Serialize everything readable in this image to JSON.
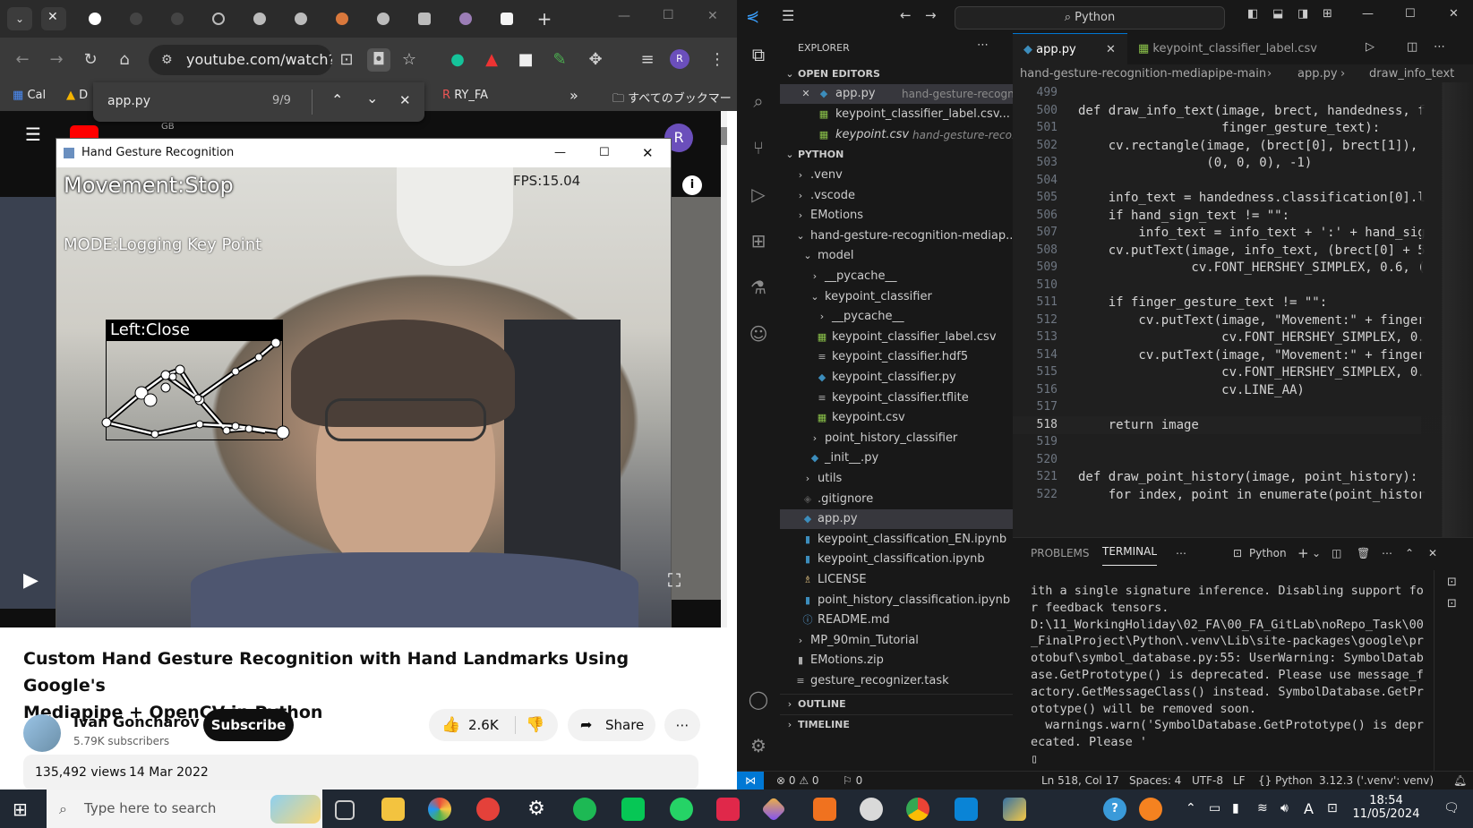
{
  "chrome": {
    "url": "youtube.com/watch?v...",
    "bookmarks": {
      "b1": "Cal",
      "b2": "D",
      "b3": "RY_FA",
      "all": "すべてのブックマーク",
      "more": "»"
    },
    "find": {
      "query": "app.py",
      "count": "9/9"
    },
    "window": {
      "minimize": "—",
      "maximize": "☐",
      "close": "✕"
    }
  },
  "cv_window": {
    "title": "Hand Gesture Recognition",
    "movement": "Movement:Stop",
    "fps": "FPS:15.04",
    "mode": "MODE:Logging Key Point",
    "hand_label": "Left:Close"
  },
  "youtube": {
    "video_title_line1": "Custom Hand Gesture Recognition with Hand Landmarks Using Google's",
    "video_title_line2": "Mediapipe + OpenCV in Python",
    "channel": "Ivan Goncharov",
    "subscribers": "5.79K subscribers",
    "subscribe": "Subscribe",
    "likes": "2.6K",
    "share": "Share",
    "views": "135,492 views",
    "date": "14 Mar 2022",
    "header_badge": "GB",
    "avatar_letter": "R"
  },
  "vscode": {
    "search": "Python",
    "explorer_title": "EXPLORER",
    "open_editors": "OPEN EDITORS",
    "open_files": [
      {
        "name": "app.py",
        "path": "hand-gesture-recogniti...",
        "icon": "python-icon",
        "close": true
      },
      {
        "name": "keypoint_classifier_label.csv...",
        "path": "",
        "icon": "csv-icon"
      },
      {
        "name": "keypoint.csv",
        "path": "hand-gesture-reco...",
        "icon": "csv-icon",
        "italic": true
      }
    ],
    "root": "PYTHON",
    "tree": [
      {
        "label": ".venv",
        "indent": 1,
        "kind": "folder",
        "open": false
      },
      {
        "label": ".vscode",
        "indent": 1,
        "kind": "folder",
        "open": false
      },
      {
        "label": "EMotions",
        "indent": 1,
        "kind": "folder",
        "open": false
      },
      {
        "label": "hand-gesture-recognition-mediap...",
        "indent": 1,
        "kind": "folder",
        "open": true
      },
      {
        "label": "model",
        "indent": 2,
        "kind": "folder",
        "open": true
      },
      {
        "label": "__pycache__",
        "indent": 3,
        "kind": "folder",
        "open": false
      },
      {
        "label": "keypoint_classifier",
        "indent": 3,
        "kind": "folder",
        "open": true
      },
      {
        "label": "__pycache__",
        "indent": 4,
        "kind": "folder",
        "open": false
      },
      {
        "label": "keypoint_classifier_label.csv",
        "indent": 4,
        "kind": "csv"
      },
      {
        "label": "keypoint_classifier.hdf5",
        "indent": 4,
        "kind": "txt"
      },
      {
        "label": "keypoint_classifier.py",
        "indent": 4,
        "kind": "py"
      },
      {
        "label": "keypoint_classifier.tflite",
        "indent": 4,
        "kind": "txt"
      },
      {
        "label": "keypoint.csv",
        "indent": 4,
        "kind": "csv"
      },
      {
        "label": "point_history_classifier",
        "indent": 3,
        "kind": "folder",
        "open": false
      },
      {
        "label": "_init__.py",
        "indent": 3,
        "kind": "py"
      },
      {
        "label": "utils",
        "indent": 2,
        "kind": "folder",
        "open": false
      },
      {
        "label": ".gitignore",
        "indent": 2,
        "kind": "git"
      },
      {
        "label": "app.py",
        "indent": 2,
        "kind": "py",
        "selected": true
      },
      {
        "label": "keypoint_classification_EN.ipynb",
        "indent": 2,
        "kind": "nb"
      },
      {
        "label": "keypoint_classification.ipynb",
        "indent": 2,
        "kind": "nb"
      },
      {
        "label": "LICENSE",
        "indent": 2,
        "kind": "lic"
      },
      {
        "label": "point_history_classification.ipynb",
        "indent": 2,
        "kind": "nb"
      },
      {
        "label": "README.md",
        "indent": 2,
        "kind": "md"
      },
      {
        "label": "MP_90min_Tutorial",
        "indent": 1,
        "kind": "folder",
        "open": false
      },
      {
        "label": "EMotions.zip",
        "indent": 1,
        "kind": "zip"
      },
      {
        "label": "gesture_recognizer.task",
        "indent": 1,
        "kind": "txt"
      }
    ],
    "outline": "OUTLINE",
    "timeline": "TIMELINE",
    "tabs": [
      {
        "label": "app.py",
        "active": true
      },
      {
        "label": "keypoint_classifier_label.csv",
        "active": false
      }
    ],
    "breadcrumb": [
      "hand-gesture-recognition-mediapipe-main",
      "app.py",
      "draw_info_text"
    ],
    "code": [
      {
        "n": "499",
        "t": ""
      },
      {
        "n": "500",
        "t": "def draw_info_text(image, brect, handedness, f"
      },
      {
        "n": "501",
        "t": "                   finger_gesture_text):"
      },
      {
        "n": "502",
        "t": "    cv.rectangle(image, (brect[0], brect[1]),"
      },
      {
        "n": "503",
        "t": "                 (0, 0, 0), -1)"
      },
      {
        "n": "504",
        "t": ""
      },
      {
        "n": "505",
        "t": "    info_text = handedness.classification[0].l"
      },
      {
        "n": "506",
        "t": "    if hand_sign_text != \"\":"
      },
      {
        "n": "507",
        "t": "        info_text = info_text + ':' + hand_sig"
      },
      {
        "n": "508",
        "t": "    cv.putText(image, info_text, (brect[0] + 5"
      },
      {
        "n": "509",
        "t": "               cv.FONT_HERSHEY_SIMPLEX, 0.6, ("
      },
      {
        "n": "510",
        "t": ""
      },
      {
        "n": "511",
        "t": "    if finger_gesture_text != \"\":"
      },
      {
        "n": "512",
        "t": "        cv.putText(image, \"Movement:\" + finger"
      },
      {
        "n": "513",
        "t": "                   cv.FONT_HERSHEY_SIMPLEX, 0."
      },
      {
        "n": "514",
        "t": "        cv.putText(image, \"Movement:\" + finger"
      },
      {
        "n": "515",
        "t": "                   cv.FONT_HERSHEY_SIMPLEX, 0."
      },
      {
        "n": "516",
        "t": "                   cv.LINE_AA)"
      },
      {
        "n": "517",
        "t": ""
      },
      {
        "n": "518",
        "t": "    return image",
        "current": true
      },
      {
        "n": "519",
        "t": ""
      },
      {
        "n": "520",
        "t": ""
      },
      {
        "n": "521",
        "t": "def draw_point_history(image, point_history):"
      },
      {
        "n": "522",
        "t": "    for index, point in enumerate(point_histor"
      }
    ],
    "panel": {
      "problems": "PROBLEMS",
      "terminal": "TERMINAL",
      "shell": "Python",
      "output": [
        "ith a single signature inference. Disabling support fo",
        "r feedback tensors.",
        "D:\\11_WorkingHoliday\\02_FA\\00_FA_GitLab\\noRepo_Task\\00",
        "_FinalProject\\Python\\.venv\\Lib\\site-packages\\google\\pr",
        "otobuf\\symbol_database.py:55: UserWarning: SymbolDatab",
        "ase.GetPrototype() is deprecated. Please use message_f",
        "actory.GetMessageClass() instead. SymbolDatabase.GetPr",
        "ototype() will be removed soon.",
        "  warnings.warn('SymbolDatabase.GetPrototype() is depr",
        "ecated. Please '",
        "▯"
      ]
    },
    "status": {
      "errors": "⊗ 0 ⚠ 0",
      "ports": "⚐ 0",
      "position": "Ln 518, Col 17",
      "spaces": "Spaces: 4",
      "encoding": "UTF-8",
      "eol": "LF",
      "language": "Python",
      "interpreter": "3.12.3 ('.venv': venv)"
    }
  },
  "taskbar": {
    "search_placeholder": "Type here to search",
    "time": "18:54",
    "date": "11/05/2024",
    "ime": "A"
  }
}
